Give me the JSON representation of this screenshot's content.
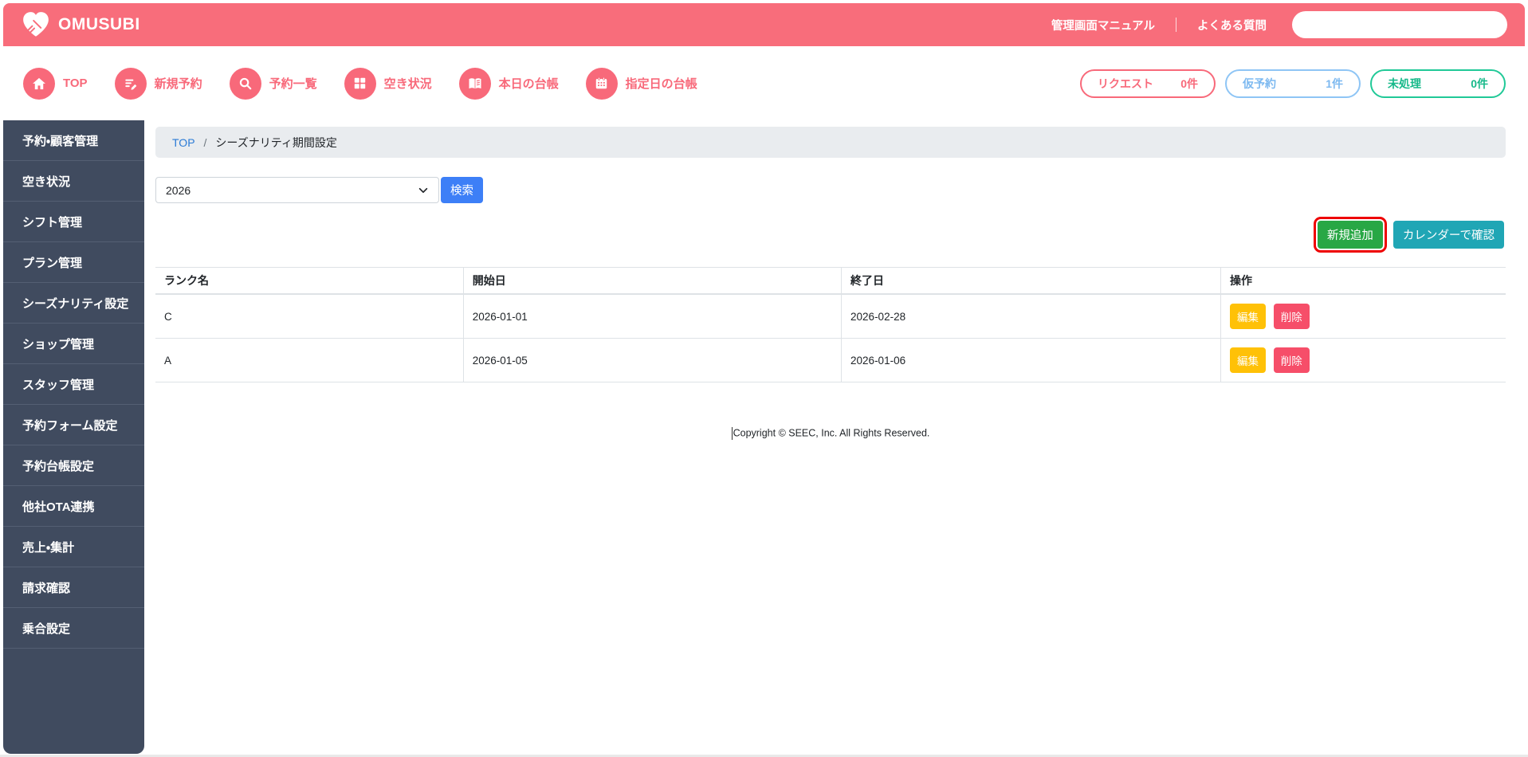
{
  "header": {
    "logo_text": "OMUSUBI",
    "manual_link": "管理画面マニュアル",
    "faq_link": "よくある質問",
    "search_placeholder": ""
  },
  "nav": {
    "items": [
      {
        "label": "TOP",
        "icon": "home-icon"
      },
      {
        "label": "新規予約",
        "icon": "compose-icon"
      },
      {
        "label": "予約一覧",
        "icon": "search-icon"
      },
      {
        "label": "空き状況",
        "icon": "grid-icon"
      },
      {
        "label": "本日の台帳",
        "icon": "book-icon"
      },
      {
        "label": "指定日の台帳",
        "icon": "calendar-icon"
      }
    ],
    "badges": [
      {
        "label": "リクエスト",
        "count": "0件",
        "color": "#f8697a"
      },
      {
        "label": "仮予約",
        "count": "1件",
        "color": "#8ec5f5"
      },
      {
        "label": "未処理",
        "count": "0件",
        "color": "#20c997"
      }
    ]
  },
  "sidebar": {
    "items": [
      {
        "label": "予約・顧客管理"
      },
      {
        "label": "空き状況"
      },
      {
        "label": "シフト管理"
      },
      {
        "label": "プラン管理"
      },
      {
        "label": "シーズナリティ設定"
      },
      {
        "label": "ショップ管理"
      },
      {
        "label": "スタッフ管理"
      },
      {
        "label": "予約フォーム設定"
      },
      {
        "label": "予約台帳設定"
      },
      {
        "label": "他社OTA連携"
      },
      {
        "label": "売上・集計"
      },
      {
        "label": "請求確認"
      },
      {
        "label": "乗合設定"
      }
    ]
  },
  "breadcrumb": {
    "home": "TOP",
    "separator": "/",
    "current": "シーズナリティ期間設定"
  },
  "filter": {
    "year_value": "2026",
    "search_button": "検索"
  },
  "actions": {
    "add_button": "新規追加",
    "calendar_button": "カレンダーで確認",
    "highlight_color": "#ee0000",
    "add_color": "#28a745",
    "calendar_color": "#20a6b5"
  },
  "table": {
    "headers": [
      "ランク名",
      "開始日",
      "終了日",
      "操作"
    ],
    "edit_button": "編集",
    "delete_button": "削除",
    "rows": [
      {
        "rank": "C",
        "start_date": "2026-01-01",
        "end_date": "2026-02-28"
      },
      {
        "rank": "A",
        "start_date": "2026-01-05",
        "end_date": "2026-01-06"
      }
    ]
  },
  "footer": {
    "copyright": "Copyright © SEEC, Inc. All Rights Reserved."
  },
  "colors": {
    "header_pink": "#f86d7b",
    "sidebar_navy": "#404b5f",
    "search_blue": "#3d7ff7",
    "edit_yellow": "#ffc107",
    "delete_red": "#f64e69",
    "badge_teal": "#20c997",
    "badge_blue": "#8ec5f5"
  }
}
